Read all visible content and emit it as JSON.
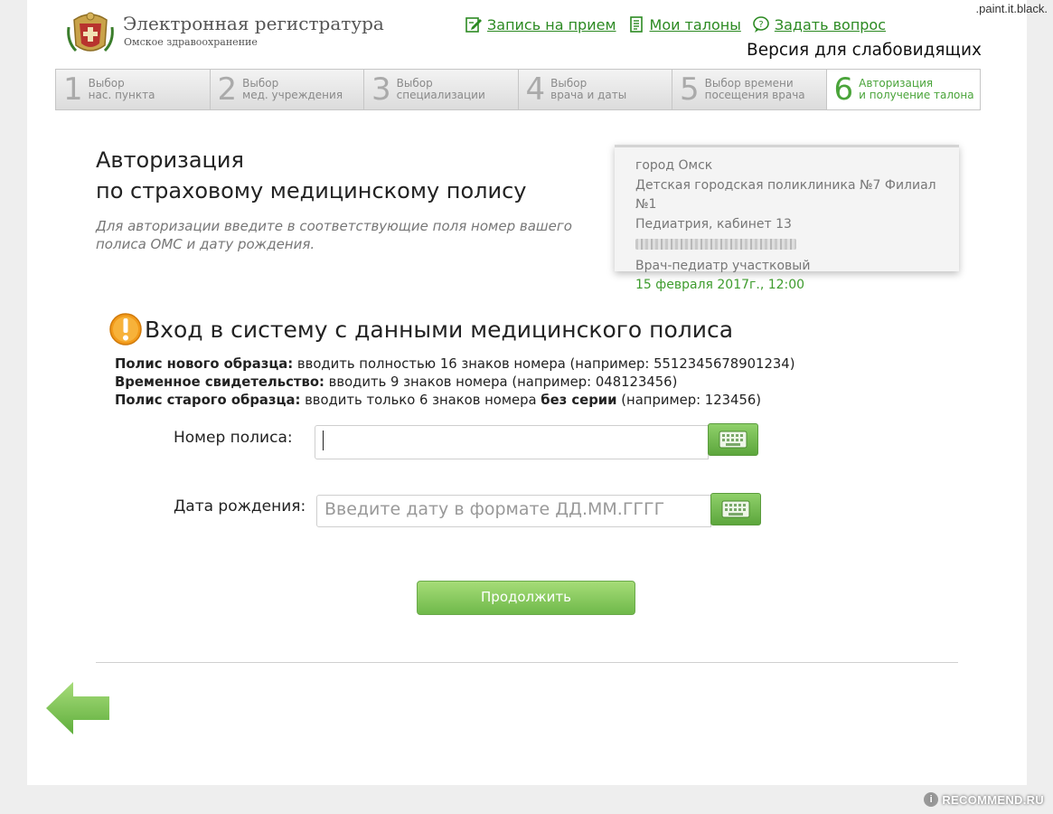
{
  "watermark": {
    "top": ".paint.it.black.",
    "bottom": "RECOMMEND.RU"
  },
  "header": {
    "title": "Электронная регистратура",
    "subtitle": "Омское здравоохранение",
    "nav": [
      {
        "label": "Запись на прием",
        "icon": "edit-icon"
      },
      {
        "label": "Мои талоны",
        "icon": "document-icon"
      },
      {
        "label": "Задать вопрос",
        "icon": "question-bubble-icon"
      }
    ],
    "vision": "Версия для слабовидящих"
  },
  "steps": [
    {
      "num": "1",
      "line1": "Выбор",
      "line2": "нас. пункта"
    },
    {
      "num": "2",
      "line1": "Выбор",
      "line2": "мед. учреждения"
    },
    {
      "num": "3",
      "line1": "Выбор",
      "line2": "специализации"
    },
    {
      "num": "4",
      "line1": "Выбор",
      "line2": "врача и даты"
    },
    {
      "num": "5",
      "line1": "Выбор времени",
      "line2": "посещения врача"
    },
    {
      "num": "6",
      "line1": "Авторизация",
      "line2": "и получение талона"
    }
  ],
  "auth": {
    "title_line1": "Авторизация",
    "title_line2": "по страховому медицинскому полису",
    "hint": "Для авторизации введите в соответствующие поля номер вашего полиса ОМС и дату рождения."
  },
  "ticket": {
    "city": "город Омск",
    "clinic": "Детская городская поликлиника №7 Филиал №1",
    "department": "Педиатрия, кабинет 13",
    "doctor": "Врач-педиатр участковый",
    "datetime": "15 февраля 2017г., 12:00"
  },
  "login": {
    "title": "Вход в систему с данными медицинского полиса",
    "rules": [
      {
        "bold": "Полис нового образца:",
        "text": " вводить полностью 16 знаков номера (например: 5512345678901234)"
      },
      {
        "bold": "Временное свидетельство:",
        "text": " вводить 9 знаков номера (например: 048123456)"
      },
      {
        "bold": "Полис старого образца:",
        "text": " вводить только 6 знаков номера ",
        "bold2": "без серии",
        "text2": " (например: 123456)"
      }
    ],
    "policy_label": "Номер полиса:",
    "policy_value": "",
    "birth_label": "Дата рождения:",
    "birth_placeholder": "Введите дату в формате ДД.ММ.ГГГГ",
    "submit": "Продолжить"
  }
}
